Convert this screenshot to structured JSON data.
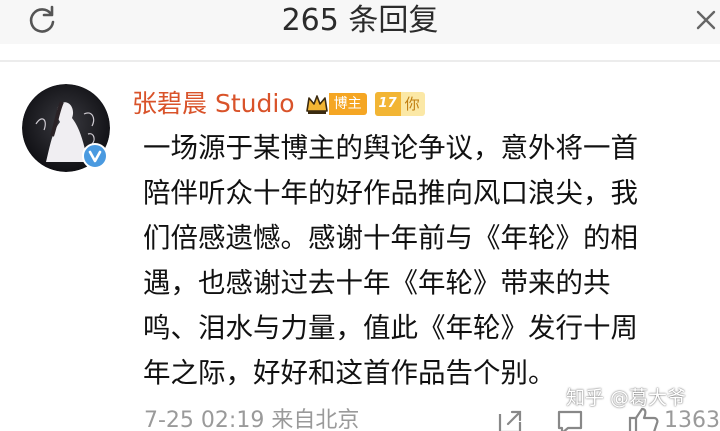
{
  "header": {
    "title": "265 条回复",
    "refresh_icon": "refresh-icon",
    "right_icon": "more-icon"
  },
  "post": {
    "author": "张碧晨 Studio",
    "badge_label": "博主",
    "level_number": "17",
    "level_label": "你",
    "verified_icon": "verified-v-icon",
    "content_lines": [
      "一场源于某博主的舆论争议，意外将一首",
      "陪伴听众十年的好作品推向风口浪尖，我",
      "们倍感遗憾。感谢十年前与《年轮》的相",
      "遇，也感谢过去十年《年轮》带来的共",
      "鸣、泪水与力量，值此《年轮》发行十周",
      "年之际，好好和这首作品告个别。"
    ],
    "meta": "7-25 02:19 来自北京",
    "like_count": "1363"
  },
  "watermark": "知乎 @葛大爷",
  "colors": {
    "author": "#d9532a",
    "badge": "#f5a623",
    "verified": "#4a9ae0",
    "meta": "#9a9a9a"
  }
}
